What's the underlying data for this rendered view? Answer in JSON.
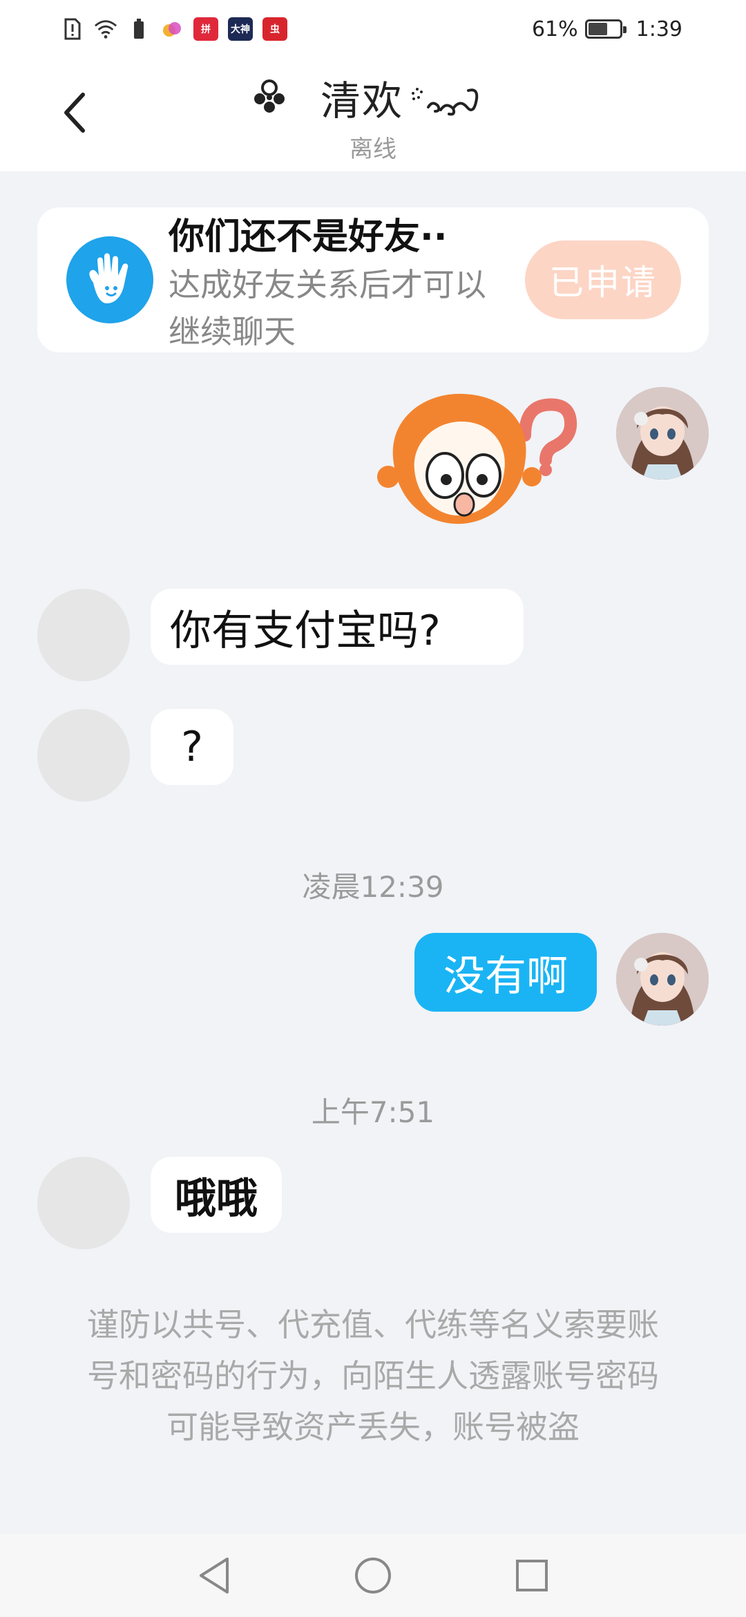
{
  "status_bar": {
    "app_badges": [
      {
        "name": "pinduoduo-app-icon",
        "text": "拼",
        "color": "#e0283b"
      },
      {
        "name": "dashen-app-icon",
        "text": "大神",
        "color": "#1d2a55"
      },
      {
        "name": "chong-app-icon",
        "text": "虫",
        "color": "#d8252d"
      }
    ],
    "battery_text": "61%",
    "battery_level": 0.61,
    "time": "1:39"
  },
  "header": {
    "title": "清欢",
    "status": "离线"
  },
  "friend_notice": {
    "title": "你们还不是好友··",
    "desc": "达成好友关系后才可以继续聊天",
    "button_label": "已申请"
  },
  "messages": {
    "msg1": "你有支付宝吗?",
    "msg2": "?",
    "time1": "凌晨12:39",
    "msg3": "没有啊",
    "time2": "上午7:51",
    "msg4": "哦哦"
  },
  "warning_text": "谨防以共号、代充值、代练等名义索要账号和密码的行为，向陌生人透露账号密码可能导致资产丢失，账号被盗",
  "colors": {
    "accent_blue": "#1ab4f4",
    "applied_button": "#fcd5c5",
    "background": "#f1f3f7"
  }
}
